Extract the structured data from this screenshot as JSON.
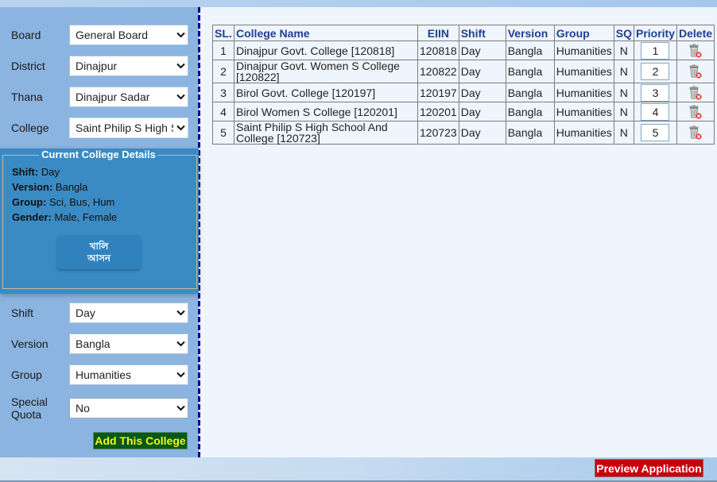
{
  "sidebar": {
    "fields_top": [
      {
        "label": "Board",
        "value": "General Board"
      },
      {
        "label": "District",
        "value": "Dinajpur"
      },
      {
        "label": "Thana",
        "value": "Dinajpur Sadar"
      },
      {
        "label": "College",
        "value": "Saint Philip S High S"
      }
    ],
    "details": {
      "legend": "Current College Details",
      "lines": [
        {
          "key": "Shift:",
          "value": "Day"
        },
        {
          "key": "Version:",
          "value": "Bangla"
        },
        {
          "key": "Group:",
          "value": "Sci, Bus, Hum"
        },
        {
          "key": "Gender:",
          "value": "Male, Female"
        }
      ],
      "seat_button_line1": "খালি",
      "seat_button_line2": "আসন"
    },
    "fields_bottom": [
      {
        "label": "Shift",
        "value": "Day"
      },
      {
        "label": "Version",
        "value": "Bangla"
      },
      {
        "label": "Group",
        "value": "Humanities"
      },
      {
        "label": "Special Quota",
        "value": "No"
      }
    ],
    "add_button": "Add This College"
  },
  "table": {
    "headers": [
      "SL.",
      "College Name",
      "EIIN",
      "Shift",
      "Version",
      "Group",
      "SQ",
      "Priority",
      "Delete"
    ],
    "rows": [
      {
        "sl": "1",
        "name": "Dinajpur Govt. College [120818]",
        "eiin": "120818",
        "shift": "Day",
        "version": "Bangla",
        "group": "Humanities",
        "sq": "N",
        "priority": "1"
      },
      {
        "sl": "2",
        "name": "Dinajpur Govt. Women S College [120822]",
        "eiin": "120822",
        "shift": "Day",
        "version": "Bangla",
        "group": "Humanities",
        "sq": "N",
        "priority": "2"
      },
      {
        "sl": "3",
        "name": "Birol Govt. College [120197]",
        "eiin": "120197",
        "shift": "Day",
        "version": "Bangla",
        "group": "Humanities",
        "sq": "N",
        "priority": "3"
      },
      {
        "sl": "4",
        "name": "Birol Women S College [120201]",
        "eiin": "120201",
        "shift": "Day",
        "version": "Bangla",
        "group": "Humanities",
        "sq": "N",
        "priority": "4"
      },
      {
        "sl": "5",
        "name": "Saint Philip S High School And College [120723]",
        "eiin": "120723",
        "shift": "Day",
        "version": "Bangla",
        "group": "Humanities",
        "sq": "N",
        "priority": "5"
      }
    ]
  },
  "footer": {
    "preview_button": "Preview Application"
  },
  "icons": {
    "dropdown": "chevron-down-icon",
    "delete": "trash-delete-icon"
  },
  "colors": {
    "sidebar_bg": "#8cb4e0",
    "details_bg": "#3a8bc4",
    "add_button_bg": "#06591b",
    "add_button_text": "#f5f518",
    "preview_button_bg": "#c8000a",
    "header_text": "#1d3f95"
  }
}
